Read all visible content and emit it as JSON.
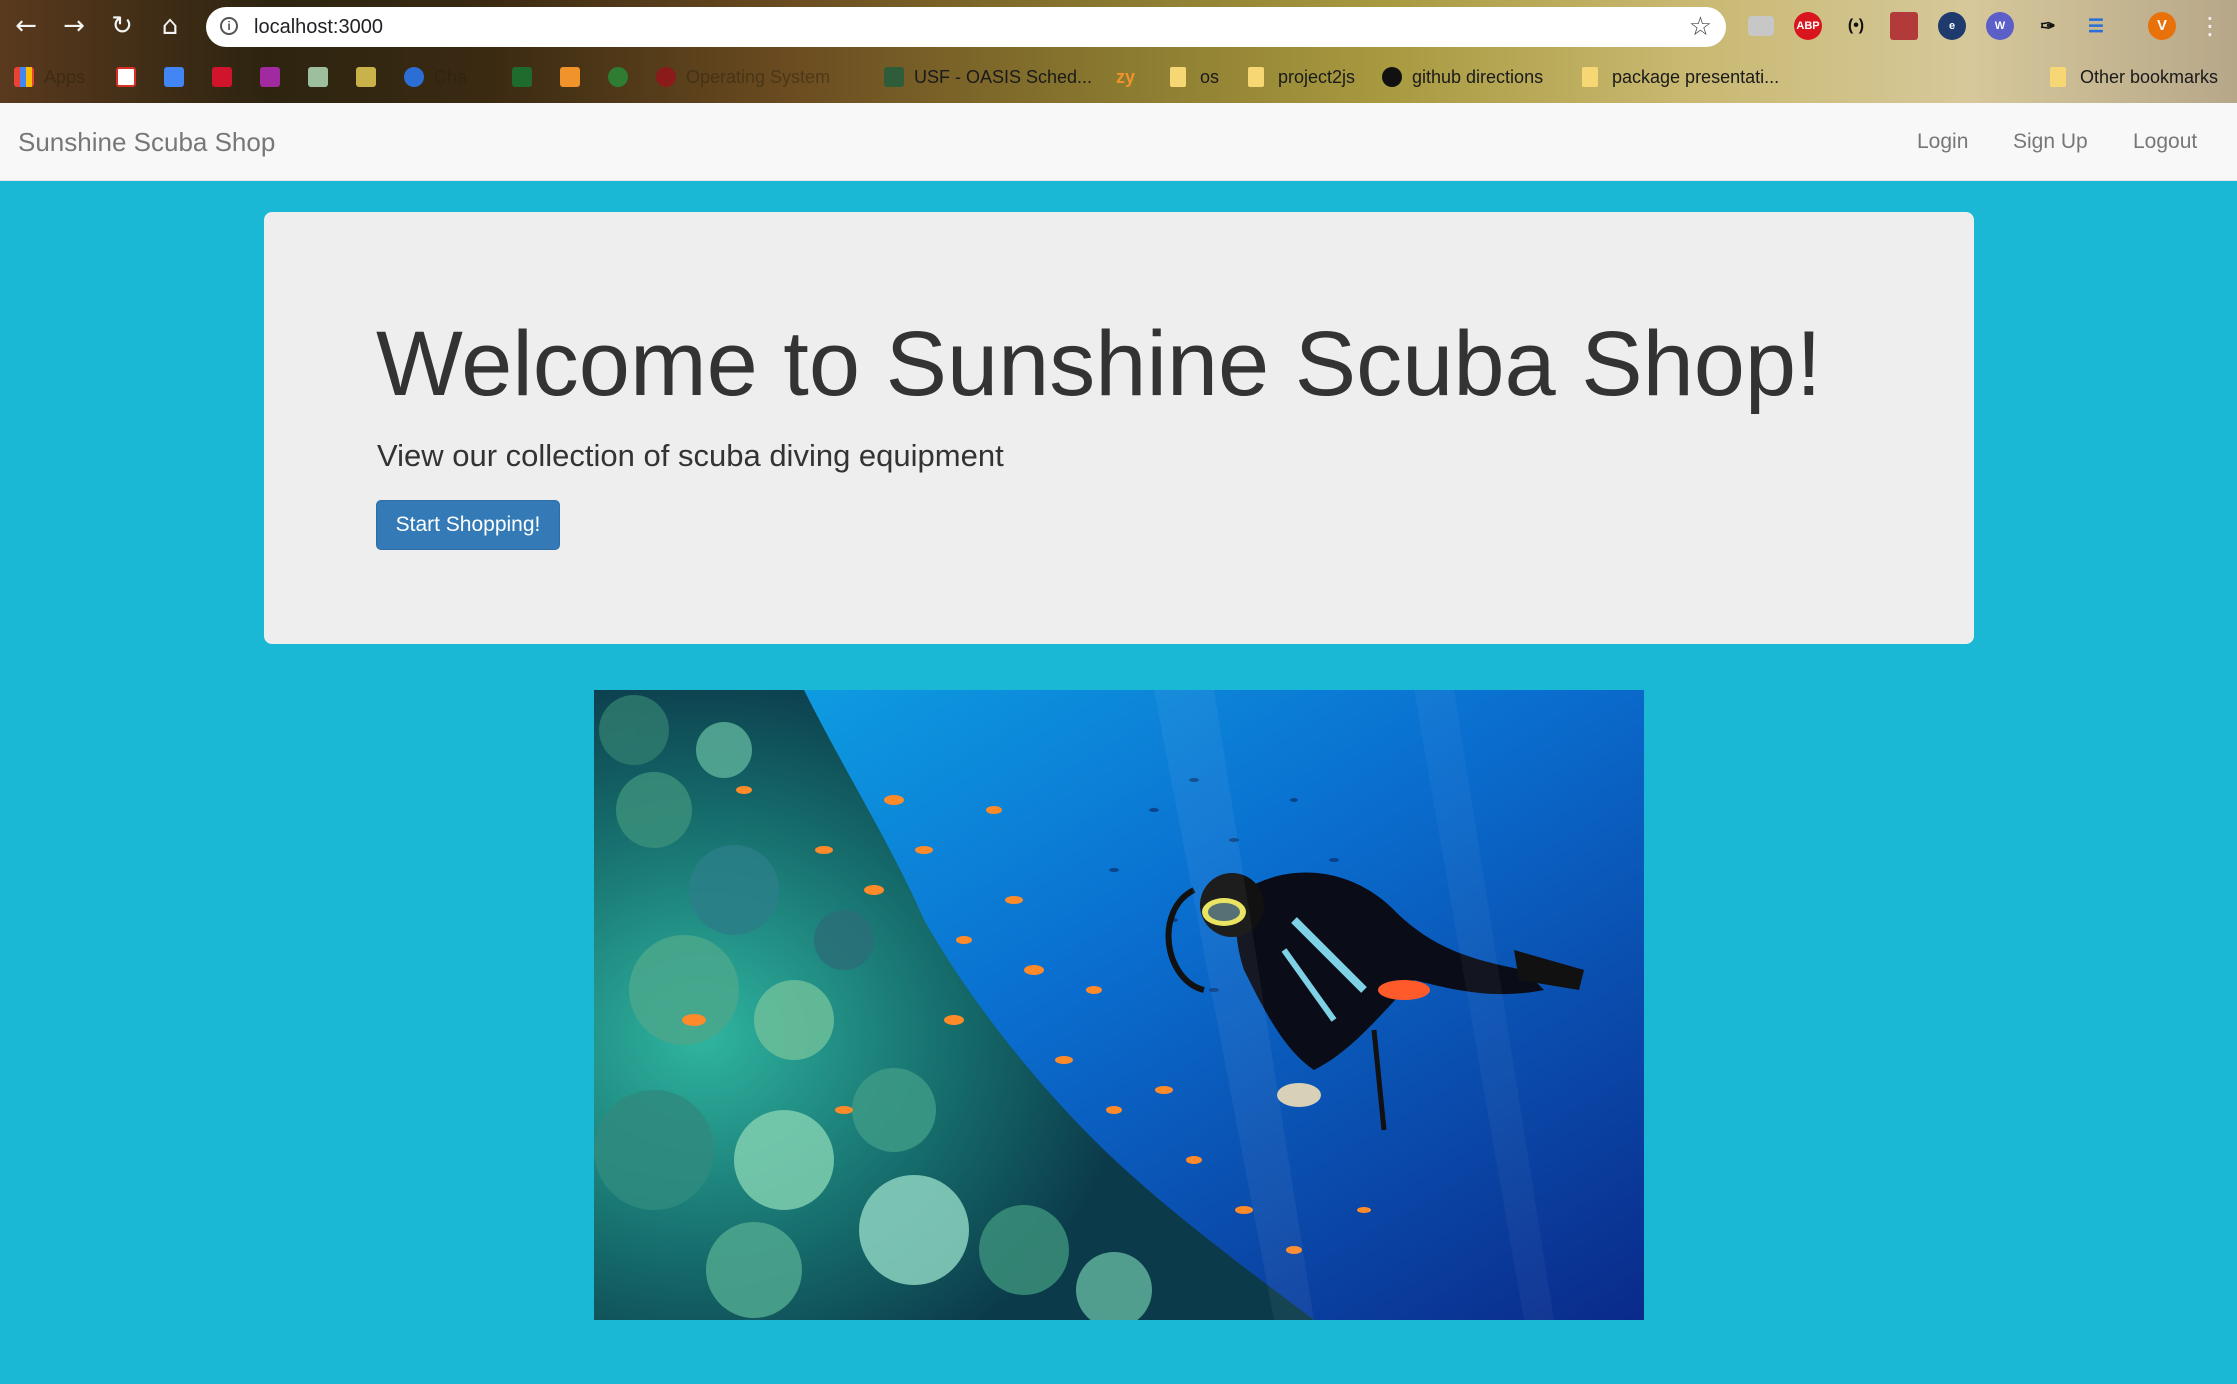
{
  "browser": {
    "url": "localhost:3000",
    "nav_icons": [
      "back-arrow-icon",
      "forward-arrow-icon",
      "reload-icon",
      "home-icon"
    ],
    "profile_initial": "V",
    "extensions": [
      "abp-icon",
      "bracket-icon",
      "pdf-icon"
    ],
    "bookmarks": [
      {
        "label": "Apps",
        "faded": true
      },
      {
        "label": "Cha",
        "faded": true
      },
      {
        "label": "Operating System",
        "faded": true
      },
      {
        "label": "USF - OASIS Sched...",
        "faded": false
      },
      {
        "label": "os",
        "faded": false
      },
      {
        "label": "project2js",
        "faded": false
      },
      {
        "label": "github directions",
        "faded": false
      },
      {
        "label": "package presentati...",
        "faded": false
      }
    ],
    "other_bookmarks": "Other bookmarks",
    "zy_label": "zy",
    "abp_label": "ABP"
  },
  "navbar": {
    "brand": "Sunshine Scuba Shop",
    "links": [
      "Login",
      "Sign Up",
      "Logout"
    ]
  },
  "jumbotron": {
    "title": "Welcome to Sunshine Scuba Shop!",
    "subtitle": "View our collection of scuba diving equipment",
    "button_label": "Start Shopping!"
  },
  "colors": {
    "page_background": "#1bb8d6",
    "jumbotron_background": "#eeeeee",
    "primary_button": "#337ab7",
    "navbar_background": "#f8f8f8"
  }
}
